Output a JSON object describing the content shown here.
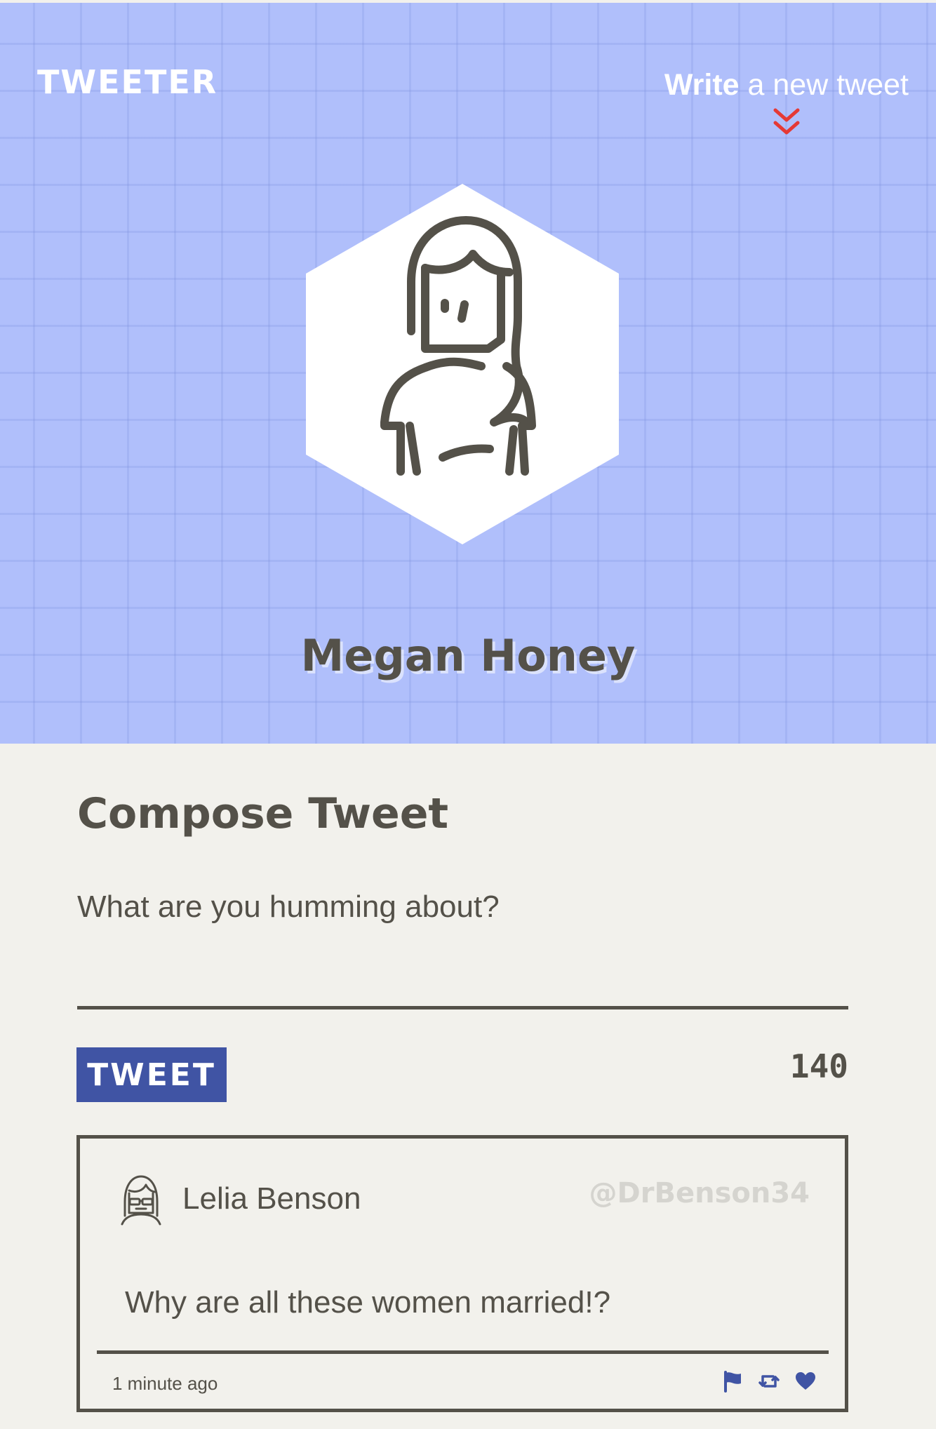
{
  "header": {
    "brand": "TWEETER",
    "write_link": {
      "strong": "Write",
      "rest": " a new tweet"
    },
    "profile_name": "Megan Honey"
  },
  "compose": {
    "title": "Compose Tweet",
    "placeholder": "What are you humming about?",
    "value": "",
    "button_label": "TWEET",
    "counter": "140"
  },
  "tweets": [
    {
      "author": "Lelia Benson",
      "handle": "@DrBenson34",
      "body": "Why are all these women married!?",
      "time": "1 minute ago",
      "actions": [
        "flag-icon",
        "retweet-icon",
        "heart-icon"
      ]
    }
  ],
  "colors": {
    "header_bg": "#b0bffb",
    "text": "#545149",
    "accent": "#4054a4",
    "chevron": "#e53935",
    "page_bg": "#f2f1ec",
    "handle": "#d5d4cf"
  }
}
